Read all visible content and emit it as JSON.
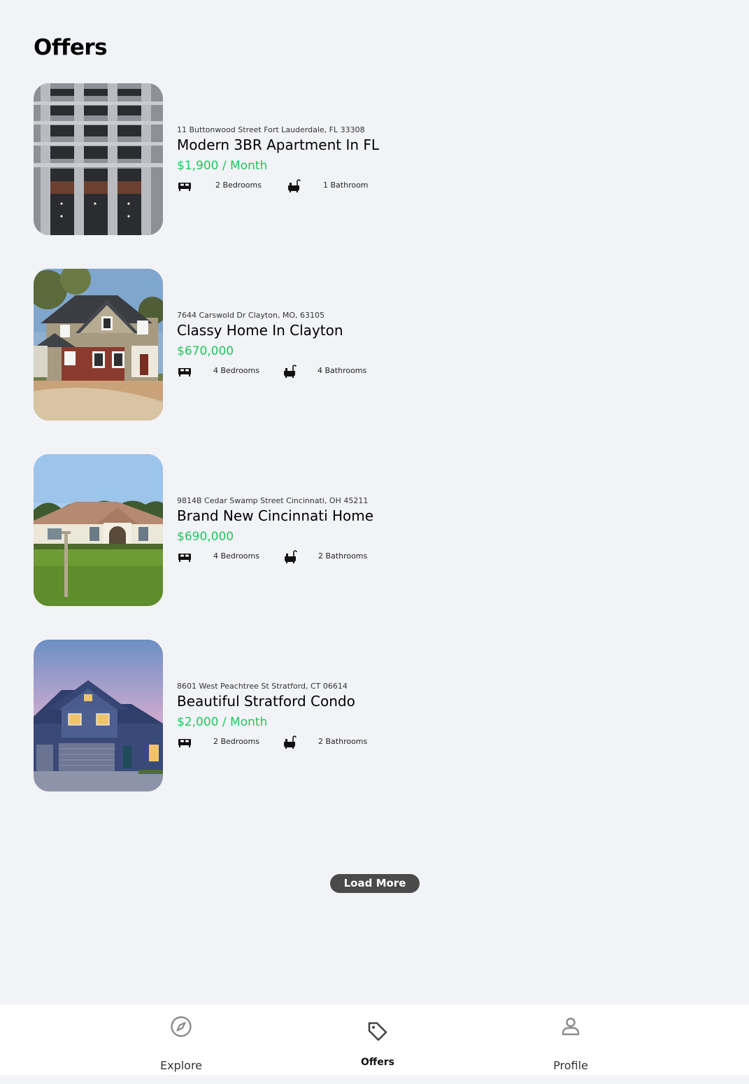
{
  "page": {
    "title": "Offers"
  },
  "listings": [
    {
      "address": "11 Buttonwood Street Fort Lauderdale, FL 33308",
      "title": "Modern 3BR Apartment In FL",
      "price": "$1,900 / Month",
      "bedrooms": "2 Bedrooms",
      "bathrooms": "1 Bathroom",
      "photo": "apartment-building"
    },
    {
      "address": "7644 Carswold Dr Clayton, MO, 63105",
      "title": "Classy Home In Clayton",
      "price": "$670,000",
      "bedrooms": "4 Bedrooms",
      "bathrooms": "4 Bathrooms",
      "photo": "two-story-house"
    },
    {
      "address": "9814B Cedar Swamp Street Cincinnati, OH 45211",
      "title": "Brand New Cincinnati Home",
      "price": "$690,000",
      "bedrooms": "4 Bedrooms",
      "bathrooms": "2 Bathrooms",
      "photo": "ranch-house"
    },
    {
      "address": "8601 West Peachtree St Stratford, CT 06614",
      "title": "Beautiful Stratford Condo",
      "price": "$2,000 / Month",
      "bedrooms": "2 Bedrooms",
      "bathrooms": "2 Bathrooms",
      "photo": "blue-house-dusk"
    }
  ],
  "load_more": {
    "label": "Load More"
  },
  "tabs": [
    {
      "label": "Explore",
      "icon": "compass-icon",
      "active": false
    },
    {
      "label": "Offers",
      "icon": "tag-icon",
      "active": true
    },
    {
      "label": "Profile",
      "icon": "user-icon",
      "active": false
    }
  ],
  "colors": {
    "background": "#f2f3f7",
    "price": "#22c55e",
    "button": "#4a4a4a",
    "tabbar": "#ffffff"
  }
}
